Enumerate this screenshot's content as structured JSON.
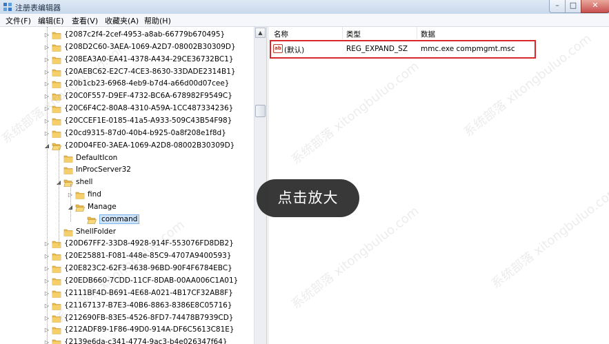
{
  "window": {
    "title": "注册表编辑器",
    "minimize": "–",
    "maximize": "□",
    "close": "✕"
  },
  "menu": [
    "文件(F)",
    "编辑(E)",
    "查看(V)",
    "收藏夹(A)",
    "帮助(H)"
  ],
  "tree": {
    "guid_keys_top": [
      "{2087c2f4-2cef-4953-a8ab-66779b670495}",
      "{208D2C60-3AEA-1069-A2D7-08002B30309D}",
      "{208EA3A0-EA41-4378-A434-29CE36732BC1}",
      "{20AEBC62-E2C7-4CE3-8630-33DADE2314B1}",
      "{20b1cb23-6968-4eb9-b7d4-a66d00d07cee}",
      "{20C0F557-D9EF-4732-BC6A-678982F9549C}",
      "{20C6F4C2-80A8-4310-A59A-1CC487334236}",
      "{20CCEF1E-0185-41a5-A933-509C43B54F98}",
      "{20cd9315-87d0-40b4-b925-0a8f208e1f8d}"
    ],
    "expanded_key": "{20D04FE0-3AEA-1069-A2D8-08002B30309D}",
    "children": {
      "default_icon": "DefaultIcon",
      "inproc_server": "InProcServer32",
      "shell": "shell",
      "find": "find",
      "manage": "Manage",
      "command": "command",
      "shell_folder": "ShellFolder"
    },
    "guid_keys_bottom": [
      "{20D67FF2-33D8-4928-914F-553076FD8DB2}",
      "{20E25881-F081-448e-85C9-4707A9400593}",
      "{20E823C2-62F3-4638-96BD-90F4F6784EBC}",
      "{20EDB660-7CDD-11CF-8DAB-00AA006C1A01}",
      "{2111BF4D-B691-4E68-A021-4B17CF32AB8F}",
      "{21167137-B7E3-40B6-8863-8386E8C05716}",
      "{212690FB-83E5-4526-8FD7-74478B7939CD}",
      "{212ADF89-1F86-49D0-914A-DF6C5613C81E}",
      "{2139e6da-c341-4774-9ac3-b4e026347f64}"
    ]
  },
  "list": {
    "headers": {
      "name": "名称",
      "type": "类型",
      "data": "数据"
    },
    "rows": [
      {
        "icon": "ab",
        "name": "(默认)",
        "type": "REG_EXPAND_SZ",
        "data": "mmc.exe compmgmt.msc"
      }
    ]
  },
  "overlay": {
    "zoom_label": "点击放大"
  },
  "watermark": "系统部落 xitongbuluo.com",
  "colors": {
    "highlight": "#d9262b",
    "selection": "#cde3f8",
    "folder": "#e8b94a"
  }
}
